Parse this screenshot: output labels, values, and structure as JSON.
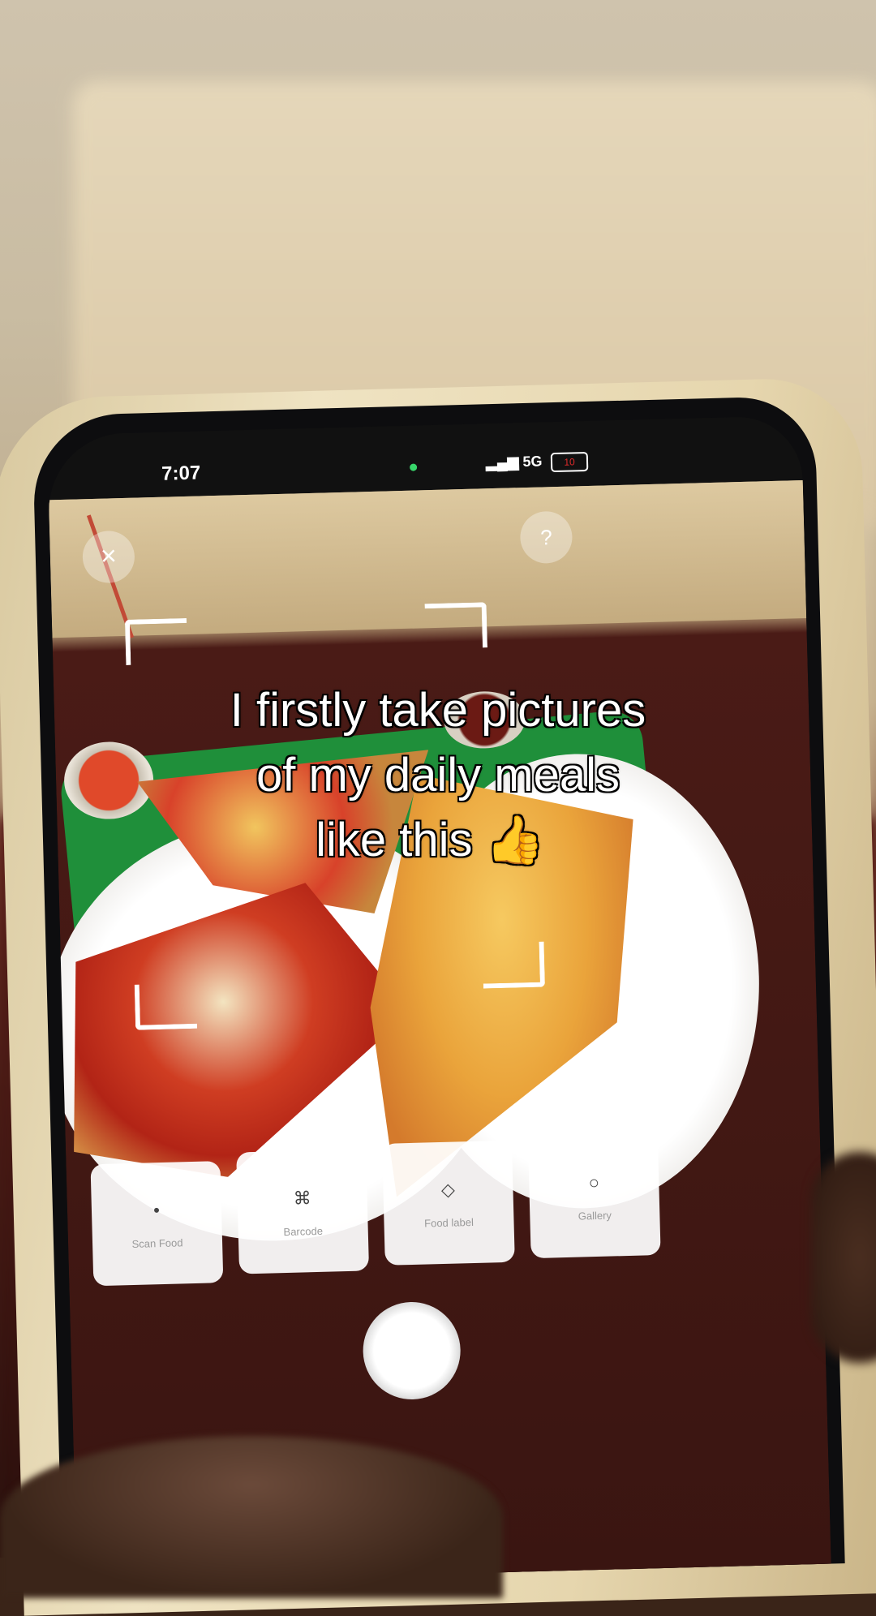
{
  "caption": {
    "line1": "I firstly take pictures",
    "line2": "of my daily meals",
    "line3": "like this 👍"
  },
  "status_bar": {
    "time": "7:07",
    "network": "5G",
    "battery": "10"
  },
  "camera": {
    "close_icon": "close-icon",
    "help_icon": "help-icon"
  },
  "modes": [
    {
      "icon": "•",
      "label": "Scan Food"
    },
    {
      "icon": "⌘",
      "label": "Barcode"
    },
    {
      "icon": "◇",
      "label": "Food label"
    },
    {
      "icon": "○",
      "label": "Gallery"
    }
  ],
  "colors": {
    "caption_text": "#ffffff",
    "tray_green": "#1f8f3a",
    "phone_case": "#e6d6ae"
  }
}
